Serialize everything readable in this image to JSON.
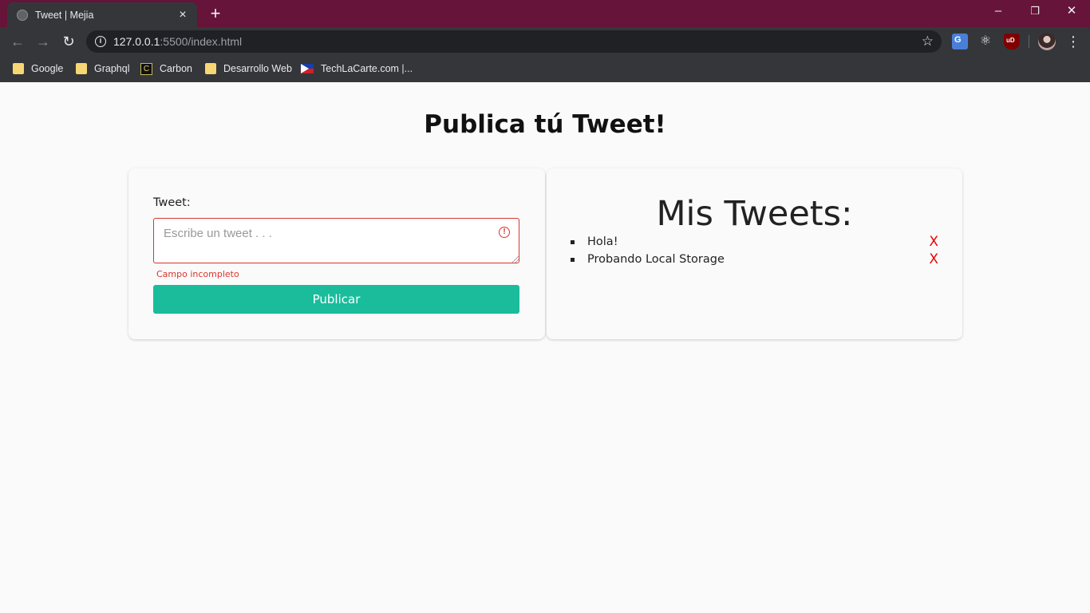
{
  "browser": {
    "tab_title": "Tweet | Mejia",
    "tab_close": "×",
    "new_tab": "+",
    "url_host": "127.0.0.1",
    "url_rest": ":5500/index.html",
    "window_controls": {
      "minimize": "–",
      "restore": "❐",
      "close": "✕"
    },
    "bookmarks": [
      {
        "label": "Google",
        "icon": "folder-icon"
      },
      {
        "label": "Graphql",
        "icon": "folder-icon"
      },
      {
        "label": "Carbon",
        "icon": "carbon-icon"
      },
      {
        "label": "Desarrollo Web",
        "icon": "folder-icon"
      },
      {
        "label": "TechLaCarte.com |...",
        "icon": "flag-icon"
      }
    ]
  },
  "page": {
    "title": "Publica tú Tweet!"
  },
  "form": {
    "label": "Tweet:",
    "placeholder": "Escribe un tweet . . .",
    "value": "",
    "alert_glyph": "!",
    "error": "Campo incompleto",
    "submit_label": "Publicar"
  },
  "list": {
    "title": "Mis Tweets:",
    "delete_label": "X",
    "items": [
      "Hola!",
      "Probando Local Storage"
    ]
  },
  "colors": {
    "titlebar": "#661439",
    "accent_button": "#1abc9c",
    "error": "#d9362e",
    "delete": "#ee0000"
  }
}
